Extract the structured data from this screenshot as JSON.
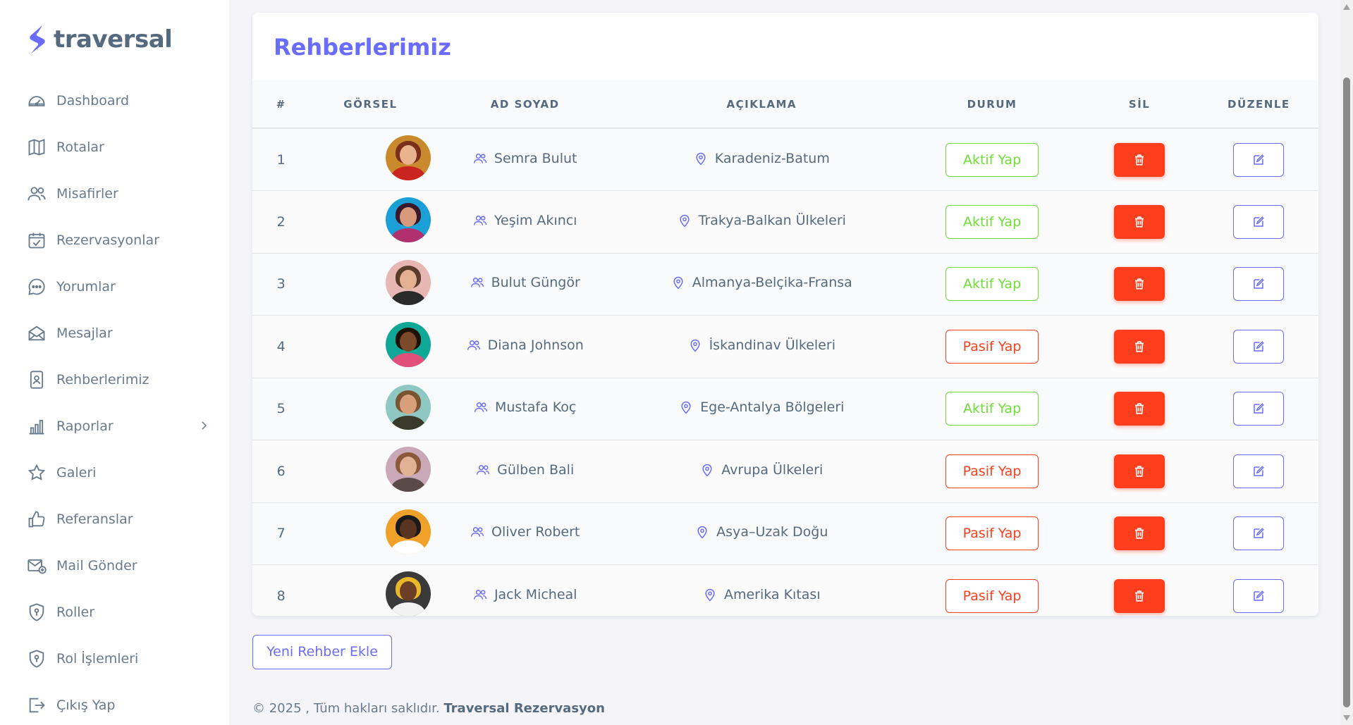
{
  "brand": {
    "name": "traversal",
    "color": "#696cff"
  },
  "sidebar": {
    "items": [
      {
        "label": "Dashboard",
        "icon": "dashboard-icon"
      },
      {
        "label": "Rotalar",
        "icon": "map-icon"
      },
      {
        "label": "Misafirler",
        "icon": "users-icon"
      },
      {
        "label": "Rezervasyonlar",
        "icon": "calendar-check-icon"
      },
      {
        "label": "Yorumlar",
        "icon": "chat-icon"
      },
      {
        "label": "Mesajlar",
        "icon": "envelope-open-icon"
      },
      {
        "label": "Rehberlerimiz",
        "icon": "id-badge-icon"
      },
      {
        "label": "Raporlar",
        "icon": "bar-chart-icon"
      },
      {
        "label": "Galeri",
        "icon": "star-icon"
      },
      {
        "label": "Referanslar",
        "icon": "thumbs-up-icon"
      },
      {
        "label": "Mail Gönder",
        "icon": "mail-send-icon"
      },
      {
        "label": "Roller",
        "icon": "shield-icon"
      },
      {
        "label": "Rol İşlemleri",
        "icon": "shield-icon"
      },
      {
        "label": "Çıkış Yap",
        "icon": "logout-icon"
      }
    ]
  },
  "page": {
    "title": "Rehberlerimiz"
  },
  "table": {
    "headers": [
      "#",
      "GÖRSEL",
      "AD SOYAD",
      "AÇIKLAMA",
      "DURUM",
      "SİL",
      "DÜZENLE"
    ],
    "rows": [
      {
        "num": "1",
        "name": "Semra Bulut",
        "desc": "Karadeniz-Batum",
        "status": "Aktif Yap",
        "state": "active",
        "avatar": {
          "bg": "#c98a2e",
          "hair": "#7a2f1a",
          "skin": "#e8b38e",
          "body": "#c9241f"
        }
      },
      {
        "num": "2",
        "name": "Yeşim Akıncı",
        "desc": "Trakya-Balkan Ülkeleri",
        "status": "Aktif Yap",
        "state": "active",
        "avatar": {
          "bg": "#1aa0d6",
          "hair": "#3a1a2a",
          "skin": "#d79a7c",
          "body": "#b0316e"
        }
      },
      {
        "num": "3",
        "name": "Bulut Güngör",
        "desc": "Almanya-Belçika-Fransa",
        "status": "Aktif Yap",
        "state": "active",
        "avatar": {
          "bg": "#e7b7b3",
          "hair": "#5b3b2a",
          "skin": "#e3b092",
          "body": "#2b2b2b"
        }
      },
      {
        "num": "4",
        "name": "Diana Johnson",
        "desc": "İskandinav Ülkeleri",
        "status": "Pasif Yap",
        "state": "passive",
        "avatar": {
          "bg": "#0fa896",
          "hair": "#1c1208",
          "skin": "#7a4a2a",
          "body": "#e0507a"
        }
      },
      {
        "num": "5",
        "name": "Mustafa Koç",
        "desc": "Ege-Antalya Bölgeleri",
        "status": "Aktif Yap",
        "state": "active",
        "avatar": {
          "bg": "#8fc7c3",
          "hair": "#7a5532",
          "skin": "#d8a07a",
          "body": "#3a3a2a"
        }
      },
      {
        "num": "6",
        "name": "Gülben Bali",
        "desc": "Avrupa Ülkeleri",
        "status": "Pasif Yap",
        "state": "passive",
        "avatar": {
          "bg": "#c9a8b8",
          "hair": "#8b5a3a",
          "skin": "#e1b295",
          "body": "#5a4a4a"
        }
      },
      {
        "num": "7",
        "name": "Oliver Robert",
        "desc": "Asya–Uzak Doğu",
        "status": "Pasif Yap",
        "state": "passive",
        "avatar": {
          "bg": "#f0a12a",
          "hair": "#1a1a1a",
          "skin": "#5a3420",
          "body": "#ffffff"
        }
      },
      {
        "num": "8",
        "name": "Jack Micheal",
        "desc": "Amerika Kıtası",
        "status": "Pasif Yap",
        "state": "passive",
        "avatar": {
          "bg": "#3a3a3a",
          "hair": "#e8b82a",
          "skin": "#6b3f26",
          "body": "#f2f2f2"
        }
      }
    ]
  },
  "actions": {
    "add_label": "Yeni Rehber Ekle"
  },
  "footer": {
    "text": "© 2025 , Tüm hakları saklıdır.",
    "brand": "Traversal Rezervasyon"
  },
  "colors": {
    "primary": "#696cff",
    "success": "#71dd37",
    "danger": "#ff3e1d",
    "text": "#566a7f"
  }
}
